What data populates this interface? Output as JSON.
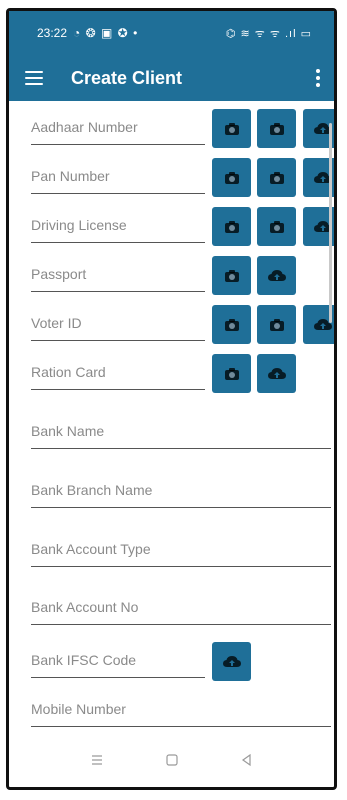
{
  "status_bar": {
    "time": "23:22",
    "left_icons": "◔ ❂ ▣ ✪ •",
    "right_icons": "⌬ ≋ ᯤ ᯤ .ıl ▭"
  },
  "app_bar": {
    "title": "Create Client",
    "menu_icon": "hamburger-menu-icon",
    "overflow_icon": "more-vert-icon"
  },
  "form": {
    "aadhaar": {
      "placeholder": "Aadhaar Number"
    },
    "pan": {
      "placeholder": "Pan Number"
    },
    "driving_license": {
      "placeholder": "Driving License"
    },
    "passport": {
      "placeholder": "Passport"
    },
    "voter_id": {
      "placeholder": "Voter ID"
    },
    "ration_card": {
      "placeholder": "Ration Card"
    },
    "bank_name": {
      "placeholder": "Bank Name"
    },
    "bank_branch_name": {
      "placeholder": "Bank Branch Name"
    },
    "bank_account_type": {
      "placeholder": "Bank Account Type"
    },
    "bank_account_no": {
      "placeholder": "Bank Account No"
    },
    "bank_ifsc_code": {
      "placeholder": "Bank IFSC Code"
    },
    "mobile_number": {
      "placeholder": "Mobile Number"
    }
  },
  "icons": {
    "camera": "camera-icon",
    "cloud_upload": "cloud-upload-icon"
  },
  "colors": {
    "primary": "#1f6f98",
    "text_hint": "#8a8a8a",
    "underline": "#555555"
  },
  "nav_bar": {
    "recent_icon": "recent-apps-icon",
    "home_icon": "home-icon",
    "back_icon": "back-icon"
  }
}
